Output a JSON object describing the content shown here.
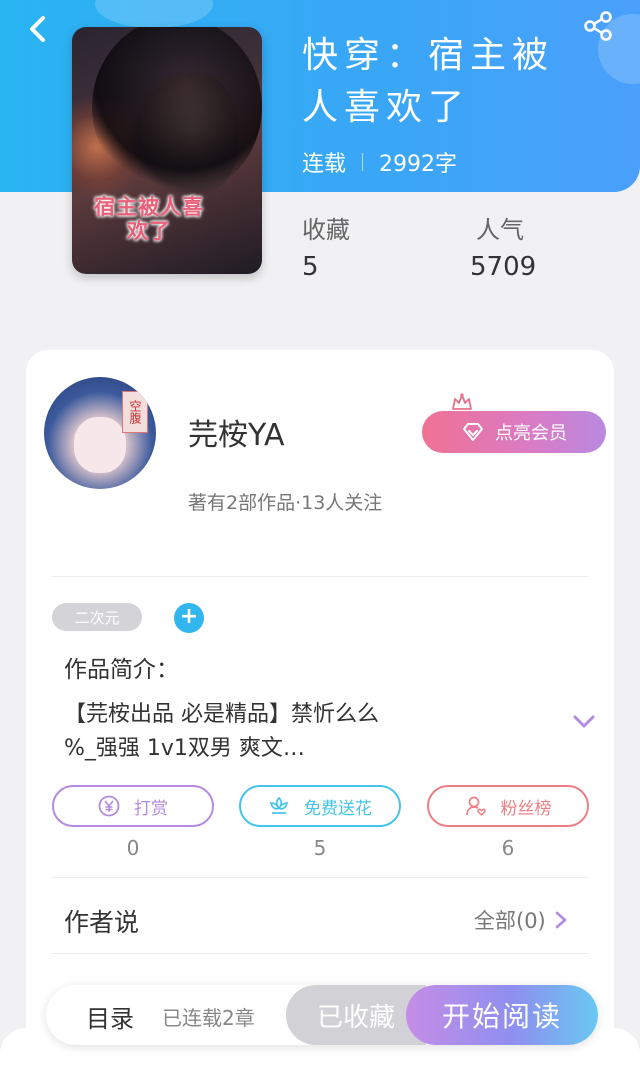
{
  "book": {
    "title_line1": "快穿：宿主被",
    "title_line2": "人喜欢了",
    "status": "连载",
    "word_count": "2992字",
    "cover_text": "宿主被人喜欢了"
  },
  "stats": {
    "favorites_label": "收藏",
    "favorites_value": "5",
    "popularity_label": "人气",
    "popularity_value": "5709"
  },
  "author": {
    "name": "芫桉YA",
    "meta": "著有2部作品·13人关注",
    "avatar_tag": "空腹",
    "vip_label": "点亮会员"
  },
  "tags": {
    "items": [
      "二次元"
    ],
    "add": "+"
  },
  "intro": {
    "label": "作品简介：",
    "text_line1": "【芫桉出品 必是精品】禁忻么么",
    "text_line2": "%_强强 1v1双男 爽文…"
  },
  "actions": [
    {
      "label": "打赏",
      "count": "0",
      "color": "#b48be0"
    },
    {
      "label": "免费送花",
      "count": "5",
      "color": "#45c4e8"
    },
    {
      "label": "粉丝榜",
      "count": "6",
      "color": "#ec7f86"
    }
  ],
  "author_say": {
    "label": "作者说",
    "all": "全部(0)"
  },
  "bottom_bar": {
    "catalog": "目录",
    "chapter_count": "已连载2章",
    "collected": "已收藏",
    "start_reading": "开始阅读"
  },
  "colors": {
    "header_blue": "#2fb0f4",
    "accent_purple": "#b48be0",
    "accent_cyan": "#45c4e8",
    "accent_red": "#ec7f86"
  }
}
